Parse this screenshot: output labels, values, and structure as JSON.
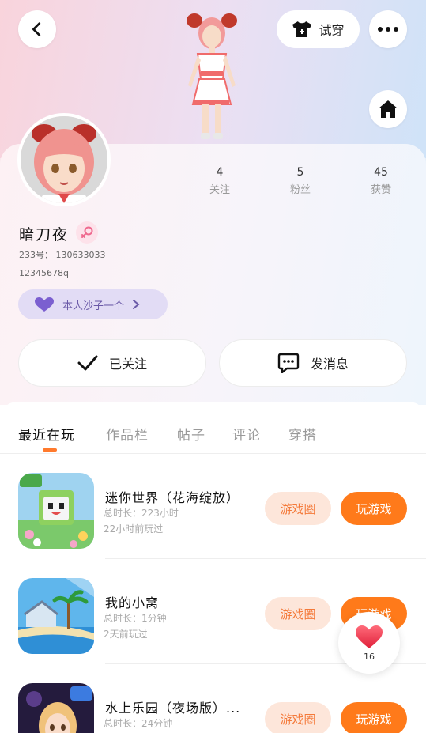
{
  "header": {
    "back_icon": "chevron-left-icon",
    "try_on_label": "试穿",
    "try_on_icon": "shirt-icon",
    "more_icon": "more-horizontal-icon",
    "home_icon": "home-icon"
  },
  "profile": {
    "name": "暗刀夜",
    "gender_icon": "female-icon",
    "id_line": "233号： 130633033",
    "signature": "12345678q",
    "bio_chip": {
      "icon": "heart-icon",
      "label": "本人沙子一个"
    }
  },
  "stats": [
    {
      "value": "4",
      "label": "关注"
    },
    {
      "value": "5",
      "label": "粉丝"
    },
    {
      "value": "45",
      "label": "获赞"
    }
  ],
  "actions": {
    "follow_label": "已关注",
    "message_label": "发消息"
  },
  "tabs": [
    {
      "label": "最近在玩",
      "active": true
    },
    {
      "label": "作品栏",
      "active": false
    },
    {
      "label": "帖子",
      "active": false
    },
    {
      "label": "评论",
      "active": false
    },
    {
      "label": "穿搭",
      "active": false
    }
  ],
  "games": [
    {
      "title": "迷你世界（花海绽放）",
      "duration": "总时长：223小时",
      "last_played": "22小时前玩过",
      "circle_label": "游戏圈",
      "play_label": "玩游戏"
    },
    {
      "title": "我的小窝",
      "duration": "总时长：1分钟",
      "last_played": "2天前玩过",
      "circle_label": "游戏圈",
      "play_label": "玩游戏"
    },
    {
      "title": "水上乐园（夜场版）...",
      "duration": "总时长：24分钟",
      "last_played": "",
      "circle_label": "游戏圈",
      "play_label": "玩游戏"
    }
  ],
  "like_fab": {
    "icon": "heart-icon",
    "count": "16"
  },
  "colors": {
    "accent": "#ff7a1a",
    "accent_soft": "#fde6da",
    "chip_bg": "#e2dcf5"
  }
}
